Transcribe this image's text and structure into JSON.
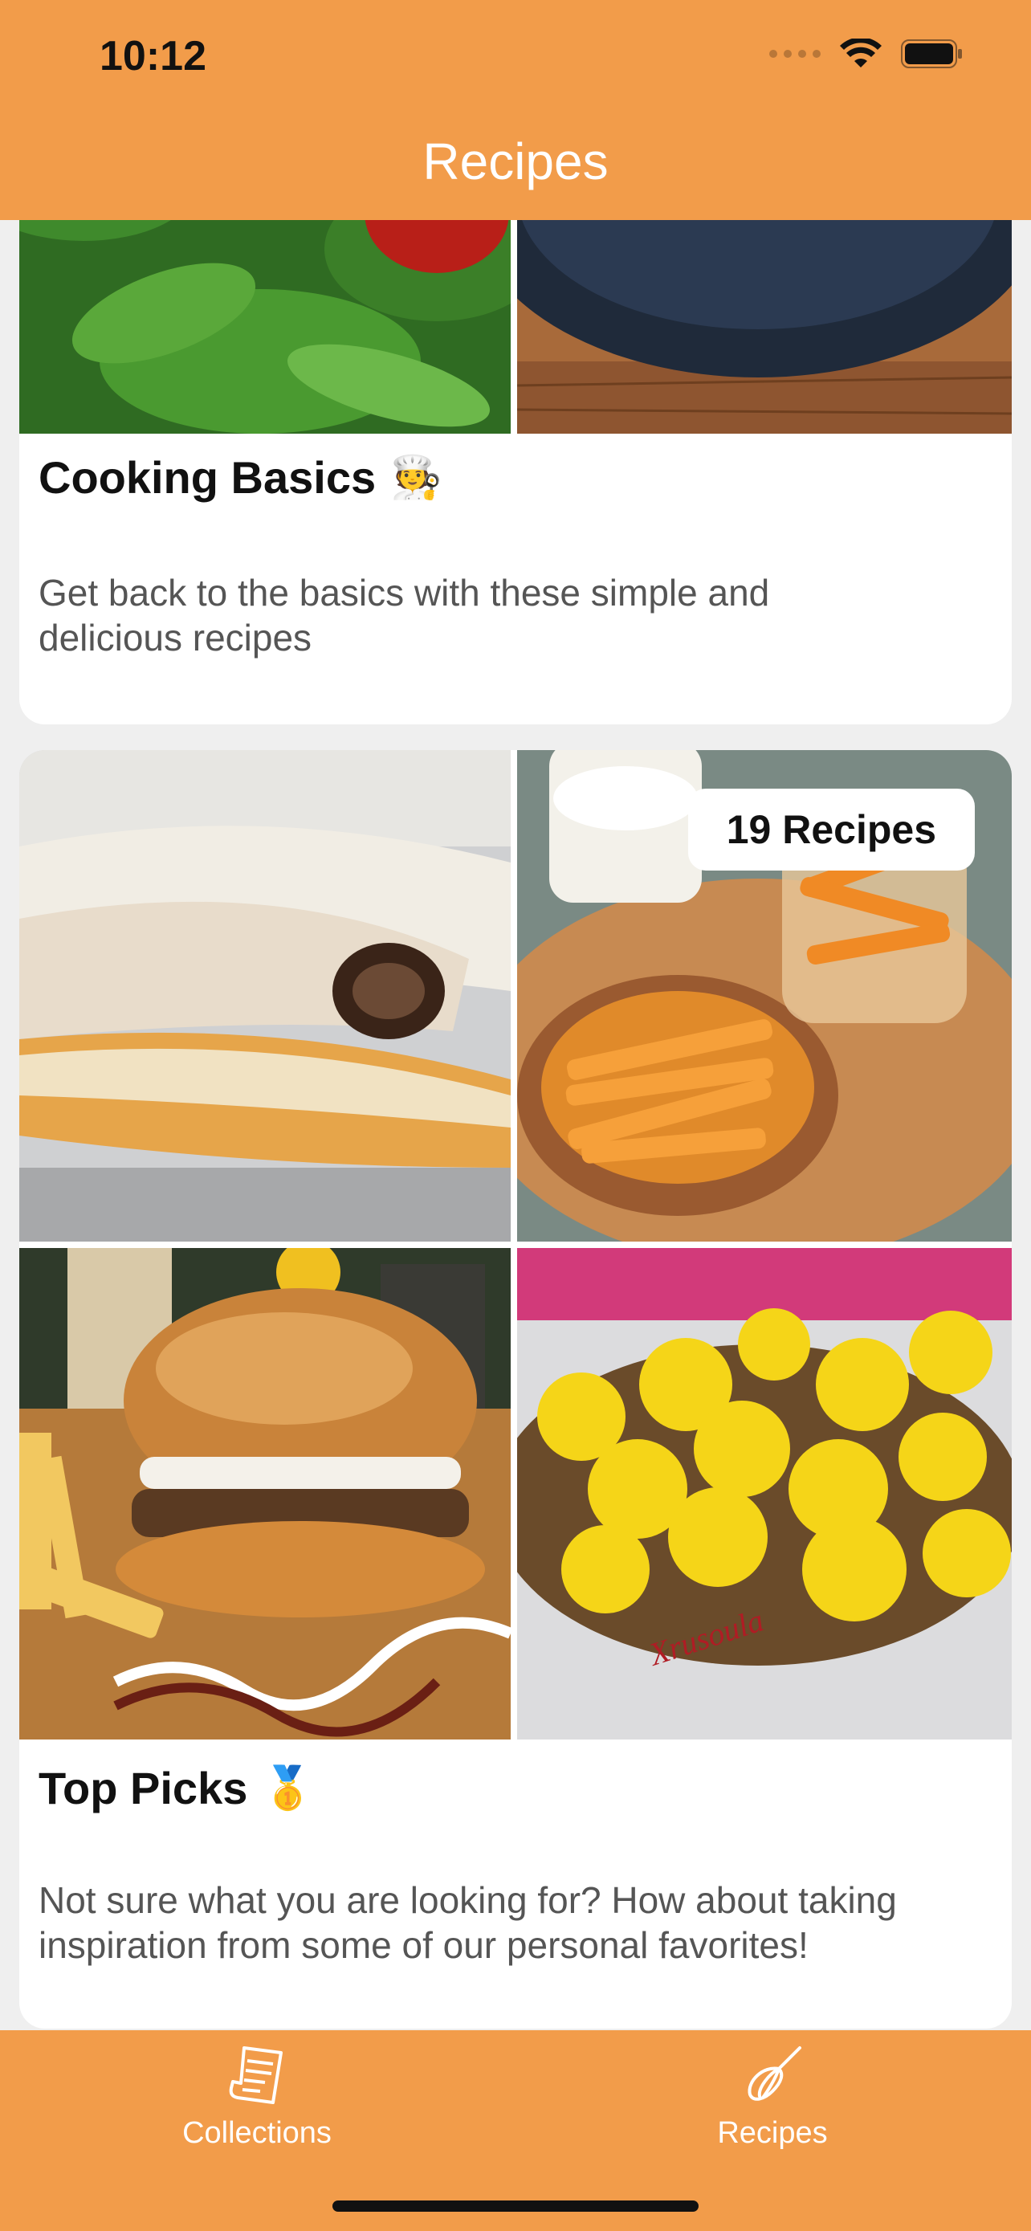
{
  "status": {
    "time": "10:12"
  },
  "header": {
    "title": "Recipes"
  },
  "collections": [
    {
      "title": "Cooking Basics",
      "emoji": "🧑‍🍳",
      "description": "Get back to the basics with these simple and delicious recipes"
    },
    {
      "title": "Top Picks",
      "emoji": "🥇",
      "badge": "19 Recipes",
      "description": "Not sure what you are looking for? How about taking inspiration from some of our personal favorites!"
    }
  ],
  "tabs": [
    {
      "label": "Collections",
      "icon": "recipe-card-icon"
    },
    {
      "label": "Recipes",
      "icon": "whisk-icon"
    }
  ],
  "colors": {
    "accent": "#F29C4A",
    "card": "#FFFFFF",
    "background": "#EFEFEF"
  }
}
